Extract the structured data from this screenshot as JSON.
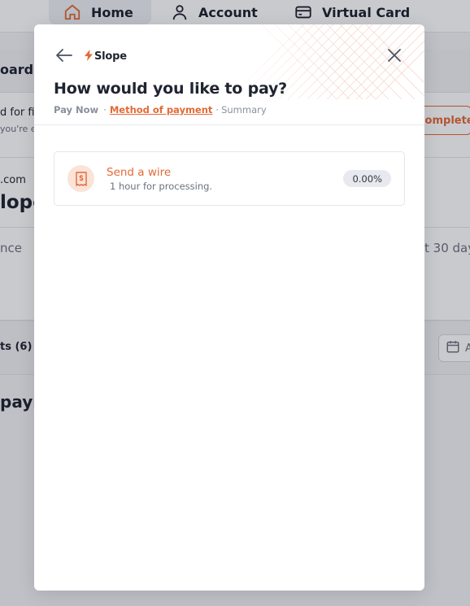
{
  "background": {
    "nav": {
      "home_label": "Home",
      "account_label": "Account",
      "virtual_card_label": "Virtual Card"
    },
    "fragments": {
      "dashboard": "oard",
      "find_line": "d for fin",
      "youre_line": "you're e",
      "complete": "Complete",
      "email_suffix": ".com",
      "slope_word": "lope",
      "balance": "nce",
      "last_days": "t 30 day",
      "payments_tab": "ts (6)",
      "pay_heading": "payr",
      "cal_letter": "A"
    }
  },
  "modal": {
    "logo_text": "Slope",
    "title": "How would you like to pay?",
    "steps": {
      "step1": "Pay Now",
      "step2": "Method of payment",
      "step3": "Summary",
      "separator": "·"
    },
    "option": {
      "title": "Send a wire",
      "subtitle": "1 hour for processing.",
      "fee": "0.00%"
    }
  },
  "colors": {
    "accent": "#e36a37",
    "overlay": "rgba(10,14,30,0.22)"
  }
}
